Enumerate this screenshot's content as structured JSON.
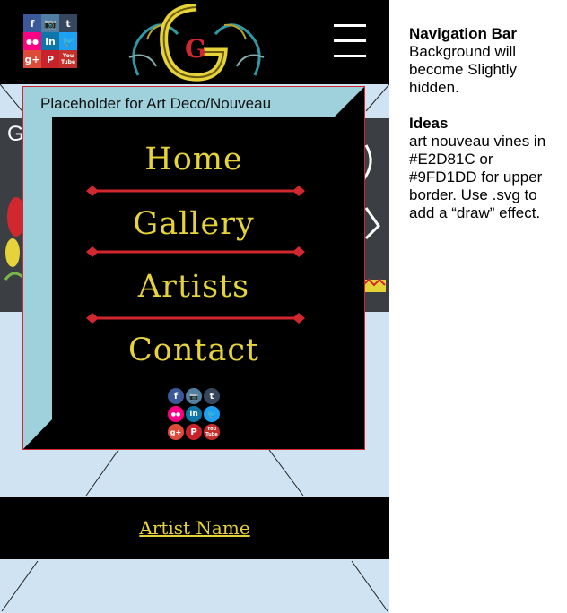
{
  "social_icons_header": [
    "f",
    "📷",
    "t",
    "●●",
    "in",
    "🐦",
    "g+",
    "P",
    "You Tube"
  ],
  "placeholder_label": "Placeholder for Art Deco/Nouveau",
  "nav": {
    "home": "Home",
    "gallery": "Gallery",
    "artists": "Artists",
    "contact": "Contact"
  },
  "artist_name": "Artist Name",
  "background_letter": "G",
  "notes": {
    "nav_heading": "Navigation Bar",
    "nav_body": "Background will become Slightly hidden.",
    "ideas_heading": "Ideas",
    "ideas_body": "art nouveau vines in #E2D81C or #9FD1DD for upper border. Use .svg to add a “draw” effect."
  },
  "colors": {
    "gold": "#E2D81C",
    "light_blue": "#9FD1DD",
    "red_divider": "#D0282E",
    "panel_black": "#000000",
    "page_bg": "#CFE3F3"
  },
  "logo_letter": "G"
}
